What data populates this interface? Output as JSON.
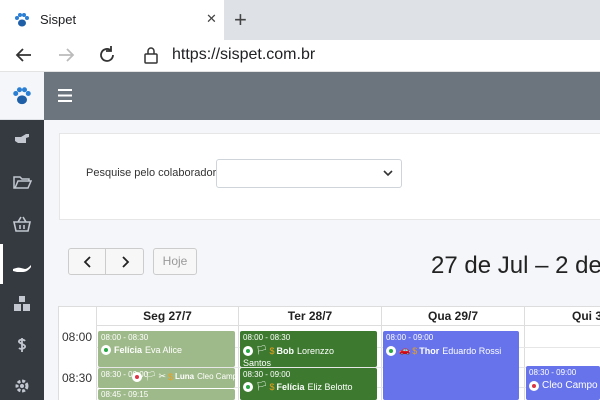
{
  "browser": {
    "tab_title": "Sispet",
    "tab_close": "✕",
    "new_tab": "+",
    "url": "https://sispet.com.br"
  },
  "sidebar": {
    "items": [
      {
        "icon": "hand-point-right-icon"
      },
      {
        "icon": "folder-open-icon"
      },
      {
        "icon": "shopping-basket-icon"
      },
      {
        "icon": "hand-holding-icon",
        "active": true
      },
      {
        "icon": "boxes-icon"
      },
      {
        "icon": "dollar-icon"
      },
      {
        "icon": "gear-icon"
      }
    ]
  },
  "filter": {
    "label": "Pesquise pelo colaborador",
    "selected": ""
  },
  "calendar": {
    "today_label": "Hoje",
    "title": "27 de Jul – 2 de",
    "days": [
      "Seg 27/7",
      "Ter 28/7",
      "Qua 29/7",
      "Qui 3"
    ],
    "times": [
      "08:00",
      "08:30"
    ]
  },
  "events": [
    {
      "time": "08:00 - 08:30",
      "pet": "Felícia",
      "owner": "Eva Alice",
      "status_color": "#28a745",
      "icons": []
    },
    {
      "time": "08:30 - 09:00",
      "pet": "Luna",
      "owner": "Cleo Campo",
      "status_color": "#dc3545",
      "icons": [
        "🏳",
        "✂",
        "$"
      ]
    },
    {
      "time": "08:45 - 09:15",
      "pet": "",
      "owner": "",
      "status_color": "",
      "icons": []
    },
    {
      "time": "08:00 - 08:30",
      "pet": "Bob",
      "owner": "Lorenzzo",
      "owner2": "Santos",
      "status_color": "#28a745",
      "icons": [
        "🏳",
        "$"
      ]
    },
    {
      "time": "08:30 - 09:00",
      "pet": "Felícia",
      "owner": "Eliz Belotto",
      "status_color": "#28a745",
      "icons": [
        "🏳",
        "$"
      ]
    },
    {
      "time": "08:00 - 09:00",
      "pet": "Thor",
      "owner": "Eduardo Rossi",
      "status_color": "#28a745",
      "icons": [
        "🚗",
        "$"
      ]
    },
    {
      "time": "08:30 - 09:00",
      "pet": "",
      "owner": "Cleo Campo",
      "status_color": "#dc3545",
      "icons": []
    }
  ],
  "colors": {
    "light_green": "#9fba8a",
    "dark_green": "#3d7a2f",
    "blue": "#6673ea",
    "dollar": "#e8a020"
  }
}
